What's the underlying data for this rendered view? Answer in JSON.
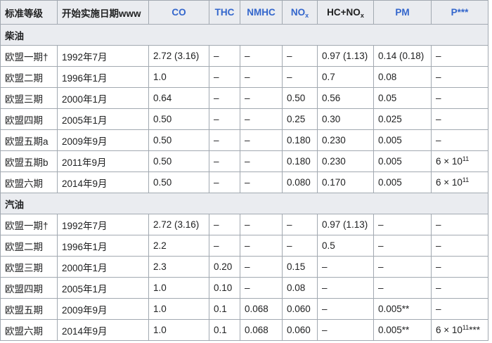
{
  "headers": [
    {
      "text": "标准等级",
      "link": false
    },
    {
      "text": "开始实施日期www",
      "link": false
    },
    {
      "text": "CO",
      "link": true
    },
    {
      "text": "THC",
      "link": true
    },
    {
      "text": "NMHC",
      "link": true
    },
    {
      "text": "NO",
      "sub": "x",
      "link": true
    },
    {
      "text": "HC+NO",
      "sub": "x",
      "link": false
    },
    {
      "text": "PM",
      "link": true
    },
    {
      "text": "P***",
      "link": true
    }
  ],
  "sections": [
    {
      "title": "柴油",
      "rows": [
        [
          {
            "t": "欧盟一期†"
          },
          {
            "t": "1992年7月"
          },
          {
            "t": "2.72 (3.16)"
          },
          {
            "t": "–"
          },
          {
            "t": "–"
          },
          {
            "t": "–"
          },
          {
            "t": "0.97 (1.13)"
          },
          {
            "t": "0.14 (0.18)"
          },
          {
            "t": "–"
          }
        ],
        [
          {
            "t": "欧盟二期"
          },
          {
            "t": "1996年1月"
          },
          {
            "t": "1.0"
          },
          {
            "t": "–"
          },
          {
            "t": "–"
          },
          {
            "t": "–"
          },
          {
            "t": "0.7"
          },
          {
            "t": "0.08"
          },
          {
            "t": "–"
          }
        ],
        [
          {
            "t": "欧盟三期"
          },
          {
            "t": "2000年1月"
          },
          {
            "t": "0.64"
          },
          {
            "t": "–"
          },
          {
            "t": "–"
          },
          {
            "t": "0.50"
          },
          {
            "t": "0.56"
          },
          {
            "t": "0.05"
          },
          {
            "t": "–"
          }
        ],
        [
          {
            "t": "欧盟四期"
          },
          {
            "t": "2005年1月"
          },
          {
            "t": "0.50"
          },
          {
            "t": "–"
          },
          {
            "t": "–"
          },
          {
            "t": "0.25"
          },
          {
            "t": "0.30"
          },
          {
            "t": "0.025"
          },
          {
            "t": "–"
          }
        ],
        [
          {
            "t": "欧盟五期a"
          },
          {
            "t": "2009年9月"
          },
          {
            "t": "0.50"
          },
          {
            "t": "–"
          },
          {
            "t": "–"
          },
          {
            "t": "0.180"
          },
          {
            "t": "0.230"
          },
          {
            "t": "0.005"
          },
          {
            "t": "–"
          }
        ],
        [
          {
            "t": "欧盟五期b"
          },
          {
            "t": "2011年9月"
          },
          {
            "t": "0.50"
          },
          {
            "t": "–"
          },
          {
            "t": "–"
          },
          {
            "t": "0.180"
          },
          {
            "t": "0.230"
          },
          {
            "t": "0.005"
          },
          {
            "t": "6 × 10",
            "sup": "11"
          }
        ],
        [
          {
            "t": "欧盟六期"
          },
          {
            "t": "2014年9月"
          },
          {
            "t": "0.50"
          },
          {
            "t": "–"
          },
          {
            "t": "–"
          },
          {
            "t": "0.080"
          },
          {
            "t": "0.170"
          },
          {
            "t": "0.005"
          },
          {
            "t": "6 × 10",
            "sup": "11"
          }
        ]
      ]
    },
    {
      "title": "汽油",
      "rows": [
        [
          {
            "t": "欧盟一期†"
          },
          {
            "t": "1992年7月"
          },
          {
            "t": "2.72 (3.16)"
          },
          {
            "t": "–"
          },
          {
            "t": "–"
          },
          {
            "t": "–"
          },
          {
            "t": "0.97 (1.13)"
          },
          {
            "t": "–"
          },
          {
            "t": "–"
          }
        ],
        [
          {
            "t": "欧盟二期"
          },
          {
            "t": "1996年1月"
          },
          {
            "t": "2.2"
          },
          {
            "t": "–"
          },
          {
            "t": "–"
          },
          {
            "t": "–"
          },
          {
            "t": "0.5"
          },
          {
            "t": "–"
          },
          {
            "t": "–"
          }
        ],
        [
          {
            "t": "欧盟三期"
          },
          {
            "t": "2000年1月"
          },
          {
            "t": "2.3"
          },
          {
            "t": "0.20"
          },
          {
            "t": "–"
          },
          {
            "t": "0.15"
          },
          {
            "t": "–"
          },
          {
            "t": "–"
          },
          {
            "t": "–"
          }
        ],
        [
          {
            "t": "欧盟四期"
          },
          {
            "t": "2005年1月"
          },
          {
            "t": "1.0"
          },
          {
            "t": "0.10"
          },
          {
            "t": "–"
          },
          {
            "t": "0.08"
          },
          {
            "t": "–"
          },
          {
            "t": "–"
          },
          {
            "t": "–"
          }
        ],
        [
          {
            "t": "欧盟五期"
          },
          {
            "t": "2009年9月"
          },
          {
            "t": "1.0"
          },
          {
            "t": "0.1"
          },
          {
            "t": "0.068"
          },
          {
            "t": "0.060"
          },
          {
            "t": "–"
          },
          {
            "t": "0.005**"
          },
          {
            "t": "–"
          }
        ],
        [
          {
            "t": "欧盟六期"
          },
          {
            "t": "2014年9月"
          },
          {
            "t": "1.0"
          },
          {
            "t": "0.1"
          },
          {
            "t": "0.068"
          },
          {
            "t": "0.060"
          },
          {
            "t": "–"
          },
          {
            "t": "0.005**"
          },
          {
            "t": "6 × 10",
            "sup": "11",
            "after": "***"
          }
        ]
      ]
    }
  ]
}
